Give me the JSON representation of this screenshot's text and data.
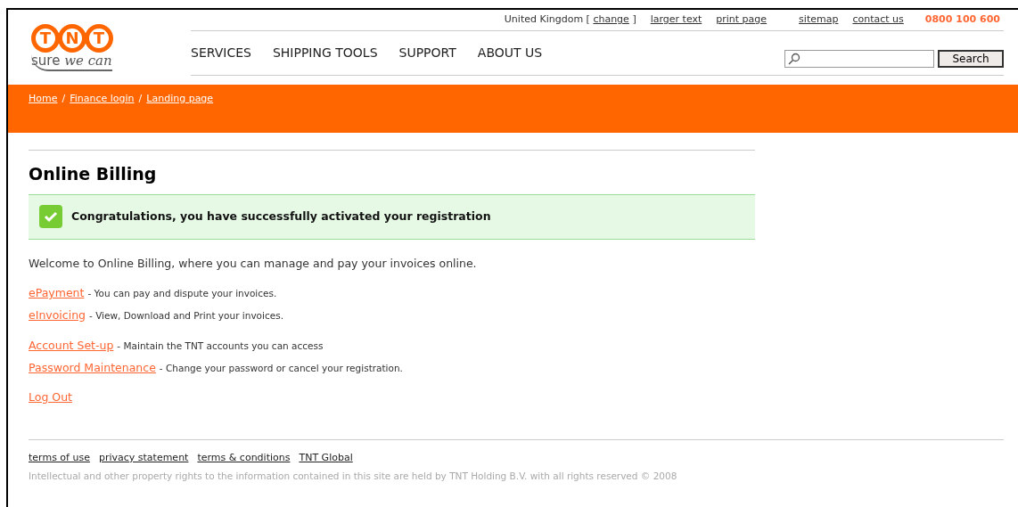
{
  "logo": {
    "letters": [
      "T",
      "N",
      "T"
    ],
    "tagline_plain": "sure",
    "tagline_script": "we can"
  },
  "utility_bar": {
    "country": "United Kingdom [",
    "change_link": "change",
    "country_close": "]",
    "links": [
      "larger text",
      "print page",
      "sitemap",
      "contact us"
    ],
    "phone": "0800 100 600"
  },
  "nav": [
    "SERVICES",
    "SHIPPING TOOLS",
    "SUPPORT",
    "ABOUT US"
  ],
  "search": {
    "button": "Search"
  },
  "breadcrumb": [
    "Home",
    "Finance login",
    "Landing page"
  ],
  "breadcrumb_separator": "/",
  "page_title": "Online Billing",
  "success_message": "Congratulations, you have successfully activated your registration",
  "intro": "Welcome to Online Billing, where you can manage and pay your invoices online.",
  "link_groups": [
    [
      {
        "link": "ePayment",
        "description": "- You can pay and dispute your invoices."
      },
      {
        "link": "eInvoicing",
        "description": "- View, Download and Print your invoices."
      }
    ],
    [
      {
        "link": "Account Set-up",
        "description": "- Maintain the TNT accounts you can access"
      },
      {
        "link": "Password Maintenance",
        "description": "- Change your password or cancel your registration."
      }
    ],
    [
      {
        "link": "Log Out"
      }
    ]
  ],
  "footer": {
    "links": [
      "terms of use",
      "privacy statement",
      "terms & conditions",
      "TNT Global"
    ],
    "copyright": "Intellectual and other property rights to the information contained in this site are held by TNT Holding B.V. with all rights reserved © 2008"
  }
}
